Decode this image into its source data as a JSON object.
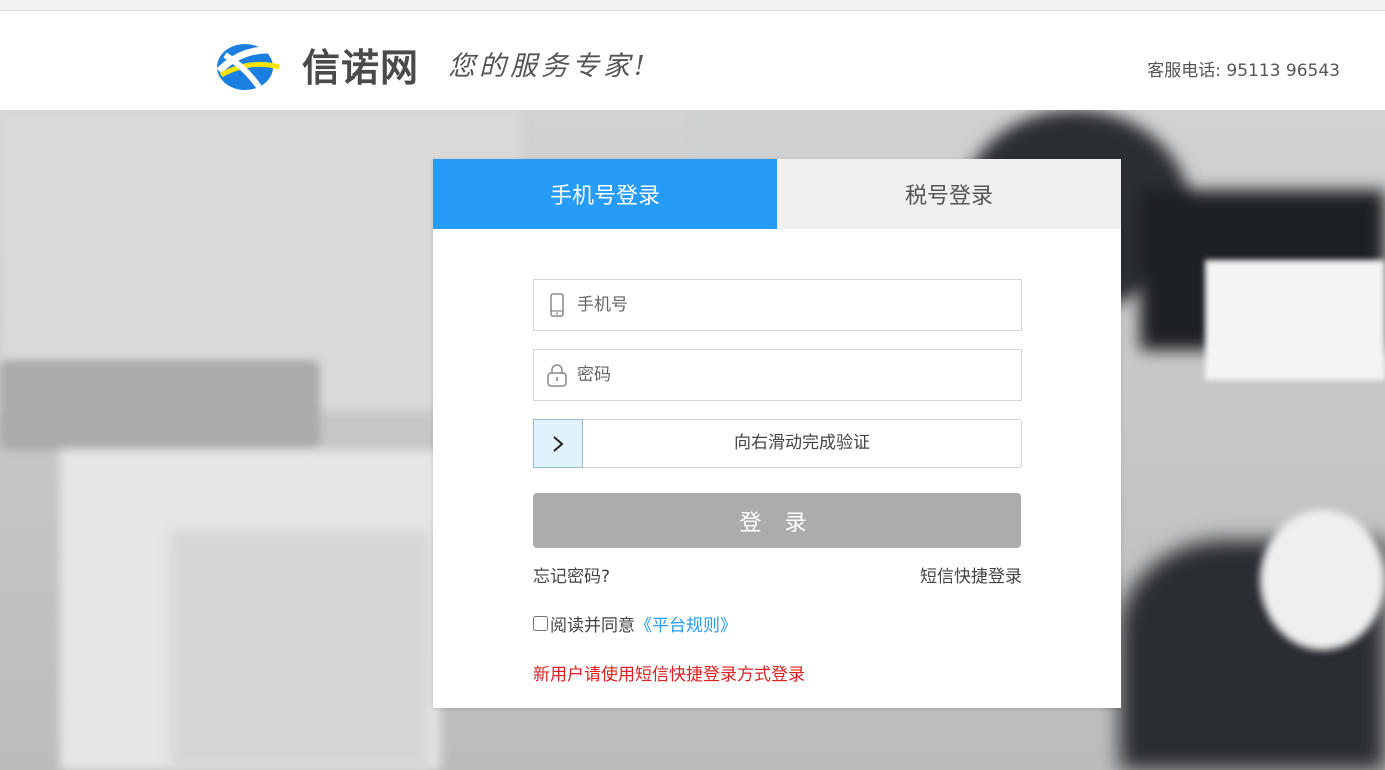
{
  "header": {
    "brand": "信诺网",
    "slogan": "您的服务专家!",
    "hotline": "客服电话: 95113 96543"
  },
  "tabs": [
    {
      "label": "手机号登录",
      "active": true
    },
    {
      "label": "税号登录",
      "active": false
    }
  ],
  "form": {
    "phone_placeholder": "手机号",
    "password_placeholder": "密码",
    "slider_text": "向右滑动完成验证",
    "login_label": "登 录",
    "forgot_label": "忘记密码?",
    "sms_login_label": "短信快捷登录",
    "agree_text": "阅读并同意",
    "rules_link": "《平台规则》",
    "agree_checked": false,
    "notice": "新用户请使用短信快捷登录方式登录"
  },
  "colors": {
    "accent": "#269cf8",
    "button_disabled": "#acacac",
    "notice": "#e02020"
  },
  "icons": [
    "logo-icon",
    "phone-icon",
    "lock-icon",
    "chevron-right-icon"
  ]
}
